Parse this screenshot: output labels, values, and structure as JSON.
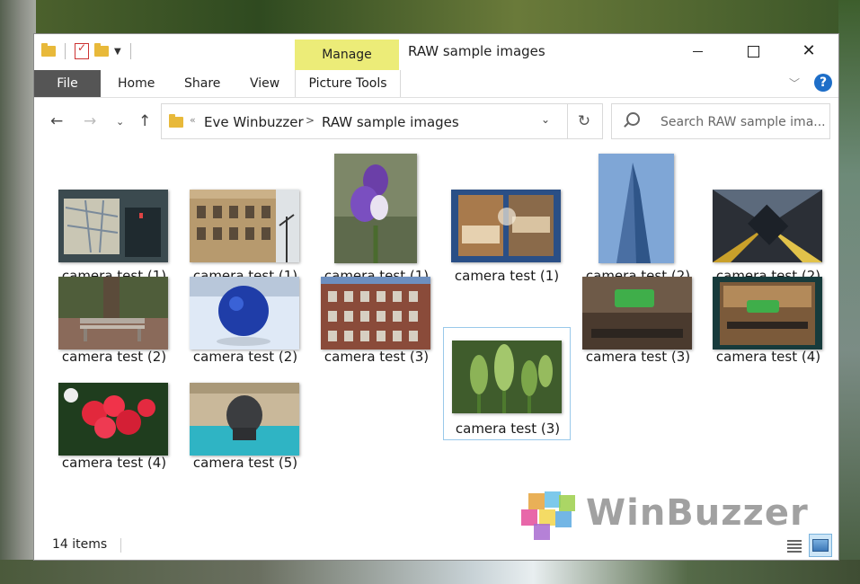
{
  "window": {
    "title": "RAW sample images",
    "manage_tab": "Manage"
  },
  "ribbon": {
    "file": "File",
    "tabs": [
      "Home",
      "Share",
      "View"
    ],
    "picture_tools": "Picture Tools"
  },
  "address": {
    "overflow_glyph": "«",
    "crumbs": [
      "Eve Winbuzzer",
      "RAW sample images"
    ],
    "separator": ">"
  },
  "search": {
    "placeholder": "Search RAW sample ima..."
  },
  "items": [
    {
      "label": "camera test (1)",
      "icon": "photo-map-thumbnail"
    },
    {
      "label": "camera test (1)",
      "icon": "photo-building-thumbnail"
    },
    {
      "label": "camera test (1)",
      "icon": "photo-iris-flower-thumbnail"
    },
    {
      "label": "camera test (1)",
      "icon": "photo-shop-window-thumbnail"
    },
    {
      "label": "camera test (2)",
      "icon": "photo-skyscraper-thumbnail"
    },
    {
      "label": "camera test (2)",
      "icon": "photo-atrium-thumbnail"
    },
    {
      "label": "camera test (2)",
      "icon": "photo-bench-tree-thumbnail"
    },
    {
      "label": "camera test (2)",
      "icon": "photo-blue-ball-thumbnail"
    },
    {
      "label": "camera test (3)",
      "icon": "photo-brick-building-thumbnail"
    },
    {
      "label": "camera test (3)",
      "icon": "photo-tulip-buds-thumbnail"
    },
    {
      "label": "camera test (3)",
      "icon": "photo-grocery-sign-thumbnail"
    },
    {
      "label": "camera test (4)",
      "icon": "photo-grocery-store-thumbnail"
    },
    {
      "label": "camera test (4)",
      "icon": "photo-red-flowers-thumbnail"
    },
    {
      "label": "camera test (5)",
      "icon": "photo-elephant-fountain-thumbnail"
    }
  ],
  "status": {
    "count": "14 items"
  },
  "watermark": {
    "text": "WinBuzzer"
  },
  "colors": {
    "manage_tab": "#ecec78",
    "file_tab": "#555555",
    "selection_border": "#99c9ea",
    "help": "#1e6ec8"
  }
}
